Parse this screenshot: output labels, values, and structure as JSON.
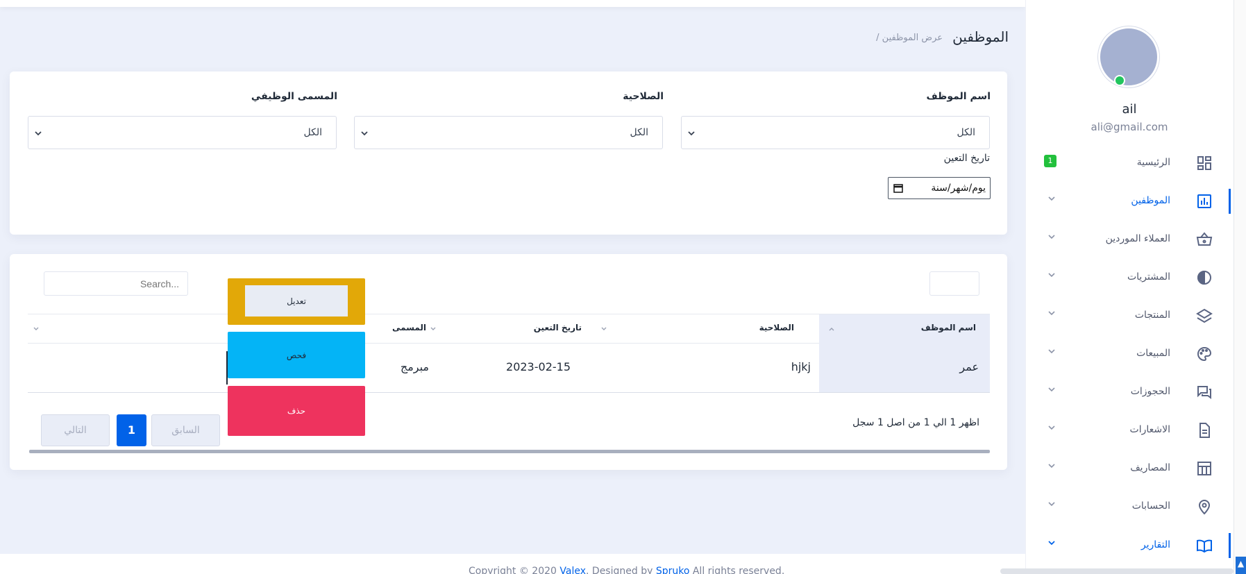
{
  "header": {
    "title": "الموظفين",
    "breadcrumb": "/ عرض الموظفين"
  },
  "user": {
    "name": "ail",
    "email": "ali@gmail.com",
    "status_color": "#22c55e"
  },
  "sidebar": {
    "items": [
      {
        "label": "الرئيسية",
        "icon": "dashboard-icon",
        "badge": "1"
      },
      {
        "label": "الموظفين",
        "icon": "bar-chart-icon",
        "active": true
      },
      {
        "label": "العملاء الموردين",
        "icon": "basket-icon"
      },
      {
        "label": "المشتريات",
        "icon": "half-circle-icon"
      },
      {
        "label": "المنتجات",
        "icon": "layers-icon"
      },
      {
        "label": "المبيعات",
        "icon": "palette-icon"
      },
      {
        "label": "الحجوزات",
        "icon": "chat-icon"
      },
      {
        "label": "الاشعارات",
        "icon": "document-icon"
      },
      {
        "label": "المصاريف",
        "icon": "table-icon"
      },
      {
        "label": "الحسابات",
        "icon": "location-pin-icon"
      },
      {
        "label": "التقارير",
        "icon": "open-book-icon",
        "active_bar": true
      }
    ]
  },
  "filters": {
    "employee_name": {
      "label": "اسم الموظف",
      "value": "الكل"
    },
    "permission": {
      "label": "الصلاحية",
      "value": "الكل"
    },
    "job_title": {
      "label": "المسمى الوظيفي",
      "value": "الكل"
    },
    "hire_date": {
      "label": "تاريخ التعين",
      "value": "يوم/شهر/سنة"
    }
  },
  "table": {
    "search_placeholder": "Search...",
    "columns": [
      "اسم الموظف",
      "الصلاحية",
      "تاريخ التعين",
      "المسمى",
      ""
    ],
    "rows": [
      {
        "name": "عمر",
        "permission": "hjkj",
        "hire_date": "2023-02-15",
        "title": "مبرمج"
      }
    ],
    "actions": {
      "edit": "تعديل",
      "check": "فحص",
      "delete": "حذف"
    },
    "info": "اظهر 1 الي 1 من اصل 1 سجل",
    "pagination": {
      "prev": "السابق",
      "current": "1",
      "next": "التالي"
    }
  },
  "footer": {
    "text_before": "Copyright © 2020",
    "brand": "Valex",
    "middle": ". Designed by",
    "designer": "Spruko",
    "text_after": "All rights reserved."
  },
  "colors": {
    "accent": "#0162e8",
    "edit": "#e2a808",
    "check": "#04b4f6",
    "delete": "#ee335e",
    "badge": "#22c03c"
  }
}
